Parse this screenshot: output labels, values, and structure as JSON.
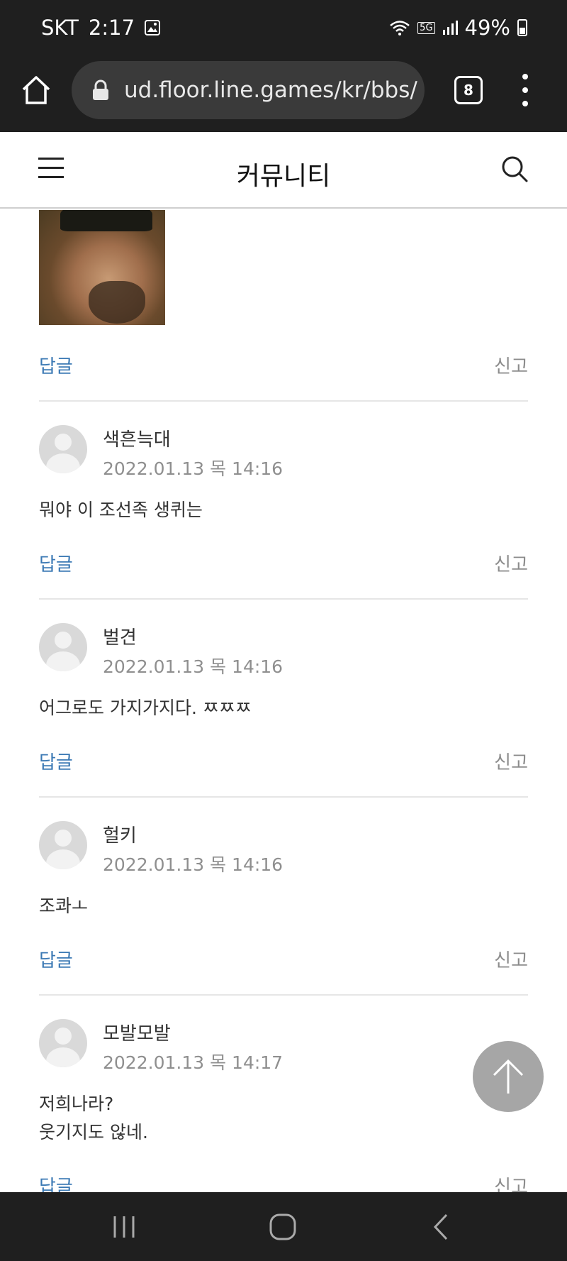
{
  "status_bar": {
    "carrier": "SKT",
    "time": "2:17",
    "network": "5G",
    "battery": "49%"
  },
  "browser": {
    "url": "ud.floor.line.games/kr/bbs/",
    "tab_count": "8"
  },
  "header": {
    "title": "커뮤니티"
  },
  "first_actions": {
    "reply": "답글",
    "report": "신고"
  },
  "comments": [
    {
      "author": "색흔늑대",
      "timestamp": "2022.01.13 목 14:16",
      "text": "뭐야 이 조선족 생퀴는",
      "reply": "답글",
      "report": "신고"
    },
    {
      "author": "벌견",
      "timestamp": "2022.01.13 목 14:16",
      "text": "어그로도 가지가지다. ㅉㅉㅉ",
      "reply": "답글",
      "report": "신고"
    },
    {
      "author": "헐키",
      "timestamp": "2022.01.13 목 14:16",
      "text": "조콰ㅗ",
      "reply": "답글",
      "report": "신고"
    },
    {
      "author": "모발모발",
      "timestamp": "2022.01.13 목 14:17",
      "text": "저희나라?\n웃기지도 않네.",
      "reply": "답글",
      "report": "신고"
    }
  ],
  "icons": {
    "home": "home-icon",
    "lock": "lock-icon",
    "menu": "more-vert-icon",
    "hamburger": "hamburger-icon",
    "search": "search-icon",
    "scroll_top": "arrow-up-icon",
    "avatar": "default-avatar-icon"
  },
  "colors": {
    "reply_link": "#3b79b4",
    "report_link": "#8c8c8c",
    "chrome_bg": "#1f1f1f",
    "url_box": "#3a3a3a",
    "scroll_top_btn": "#a6a6a6"
  }
}
